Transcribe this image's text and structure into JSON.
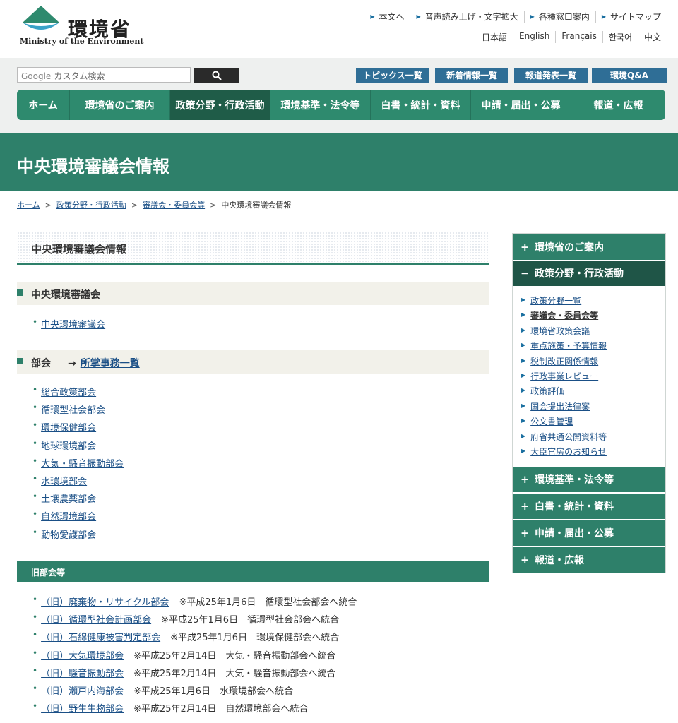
{
  "header": {
    "logo_jp": "環境省",
    "logo_en": "Ministry of the Environment",
    "util_links": [
      "本文へ",
      "音声読み上げ・文字拡大",
      "各種窓口案内",
      "サイトマップ"
    ],
    "languages": [
      "日本語",
      "English",
      "Français",
      "한국어",
      "中文"
    ]
  },
  "search": {
    "placeholder": "カスタム検索",
    "brand": "Google"
  },
  "quick_links": [
    "トピックス一覧",
    "新着情報一覧",
    "報道発表一覧",
    "環境Q&A"
  ],
  "global_nav": [
    "ホーム",
    "環境省のご案内",
    "政策分野・行政活動",
    "環境基準・法令等",
    "白書・統計・資料",
    "申請・届出・公募",
    "報道・広報"
  ],
  "global_nav_active": "政策分野・行政活動",
  "page_title": "中央環境審議会情報",
  "breadcrumb": [
    "ホーム",
    "政策分野・行政活動",
    "審議会・委員会等",
    "中央環境審議会情報"
  ],
  "content_title": "中央環境審議会情報",
  "section1": {
    "title": "中央環境審議会",
    "items": [
      "中央環境審議会"
    ]
  },
  "section2": {
    "title": "部会",
    "arrow": "→",
    "link": "所掌事務一覧",
    "items": [
      "総合政策部会",
      "循環型社会部会",
      "環境保健部会",
      "地球環境部会",
      "大気・騒音振動部会",
      "水環境部会",
      "土壌農薬部会",
      "自然環境部会",
      "動物愛護部会"
    ]
  },
  "old_section": {
    "title": "旧部会等",
    "items": [
      {
        "name": "（旧）廃棄物・リサイクル部会",
        "note": "※平成25年1月6日　循環型社会部会へ統合"
      },
      {
        "name": "（旧）循環型社会計画部会",
        "note": "※平成25年1月6日　循環型社会部会へ統合"
      },
      {
        "name": "（旧）石綿健康被害判定部会",
        "note": "※平成25年1月6日　環境保健部会へ統合"
      },
      {
        "name": "（旧）大気環境部会",
        "note": "※平成25年2月14日　大気・騒音振動部会へ統合"
      },
      {
        "name": "（旧）騒音振動部会",
        "note": "※平成25年2月14日　大気・騒音振動部会へ統合"
      },
      {
        "name": "（旧）瀬戸内海部会",
        "note": "※平成25年1月6日　水環境部会へ統合"
      },
      {
        "name": "（旧）野生生物部会",
        "note": "※平成25年2月14日　自然環境部会へ統合"
      }
    ]
  },
  "side_nav": {
    "top": {
      "label": "環境省のご案内",
      "sign": "+"
    },
    "open": {
      "label": "政策分野・行政活動",
      "sign": "−"
    },
    "sub_items": [
      "政策分野一覧",
      "審議会・委員会等",
      "環境省政策会議",
      "重点施策・予算情報",
      "税制改正関係情報",
      "行政事業レビュー",
      "政策評価",
      "国会提出法律案",
      "公文書管理",
      "府省共通公開資料等",
      "大臣官房のお知らせ"
    ],
    "current": "審議会・委員会等",
    "bottom": [
      {
        "label": "環境基準・法令等",
        "sign": "+"
      },
      {
        "label": "白書・統計・資料",
        "sign": "+"
      },
      {
        "label": "申請・届出・公募",
        "sign": "+"
      },
      {
        "label": "報道・広報",
        "sign": "+"
      }
    ]
  },
  "colors": {
    "primary_green": "#2e806a",
    "nav_green": "#2e8a6e",
    "active_dark": "#1f5c48",
    "link_blue": "#1a4f86",
    "quick_blue": "#2f6e96"
  }
}
